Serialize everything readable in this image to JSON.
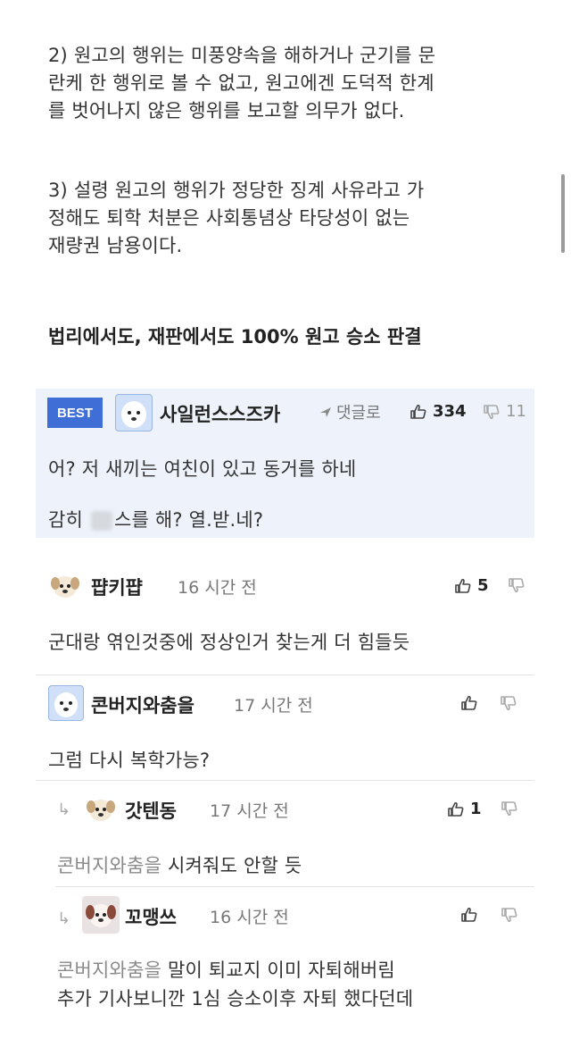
{
  "article": {
    "para2": [
      "2) 원고의 행위는 미풍양속을 해하거나 군기를 문",
      "란케 한 행위로 볼 수 없고, 원고에겐 도덕적 한계",
      "를 벗어나지 않은 행위를 보고할 의무가 없다."
    ],
    "para3": [
      "3) 설령 원고의 행위가 정당한 징계 사유라고 가",
      "정해도 퇴학 처분은 사회통념상 타당성이 없는",
      "재량권 남용이다."
    ],
    "headline": "법리에서도, 재판에서도 100% 원고 승소 판결"
  },
  "comments": [
    {
      "badge": "BEST",
      "nick": "사일런스스즈카",
      "reply_label": "댓글로",
      "up": "334",
      "down": "11",
      "lines": [
        "어? 저 새끼는 여친이 있고 동거를 하네",
        "감히",
        "스를 해? 열.받.네?"
      ]
    },
    {
      "nick": "퍕키퍕",
      "time": "16 시간 전",
      "up": "5",
      "text": "군대랑 엮인것중에 정상인거 찾는게 더 힘들듯"
    },
    {
      "nick": "콘버지와춤을",
      "time": "17 시간 전",
      "text": "그럼 다시 복학가능?"
    },
    {
      "nick": "갓텐동",
      "time": "17 시간 전",
      "up": "1",
      "mention": "콘버지와춤을",
      "text": "시켜줘도 안할 듯"
    },
    {
      "nick": "꼬맹쓰",
      "time": "16 시간 전",
      "mention": "콘버지와춤을",
      "text": "말이 퇴교지 이미 자퇴해버림",
      "text2": "추가 기사보니깐 1심 승소이후 자퇴 했다던데"
    }
  ],
  "colors": {
    "best_bg": "#eef3fb",
    "best_badge": "#3f6fd6"
  }
}
